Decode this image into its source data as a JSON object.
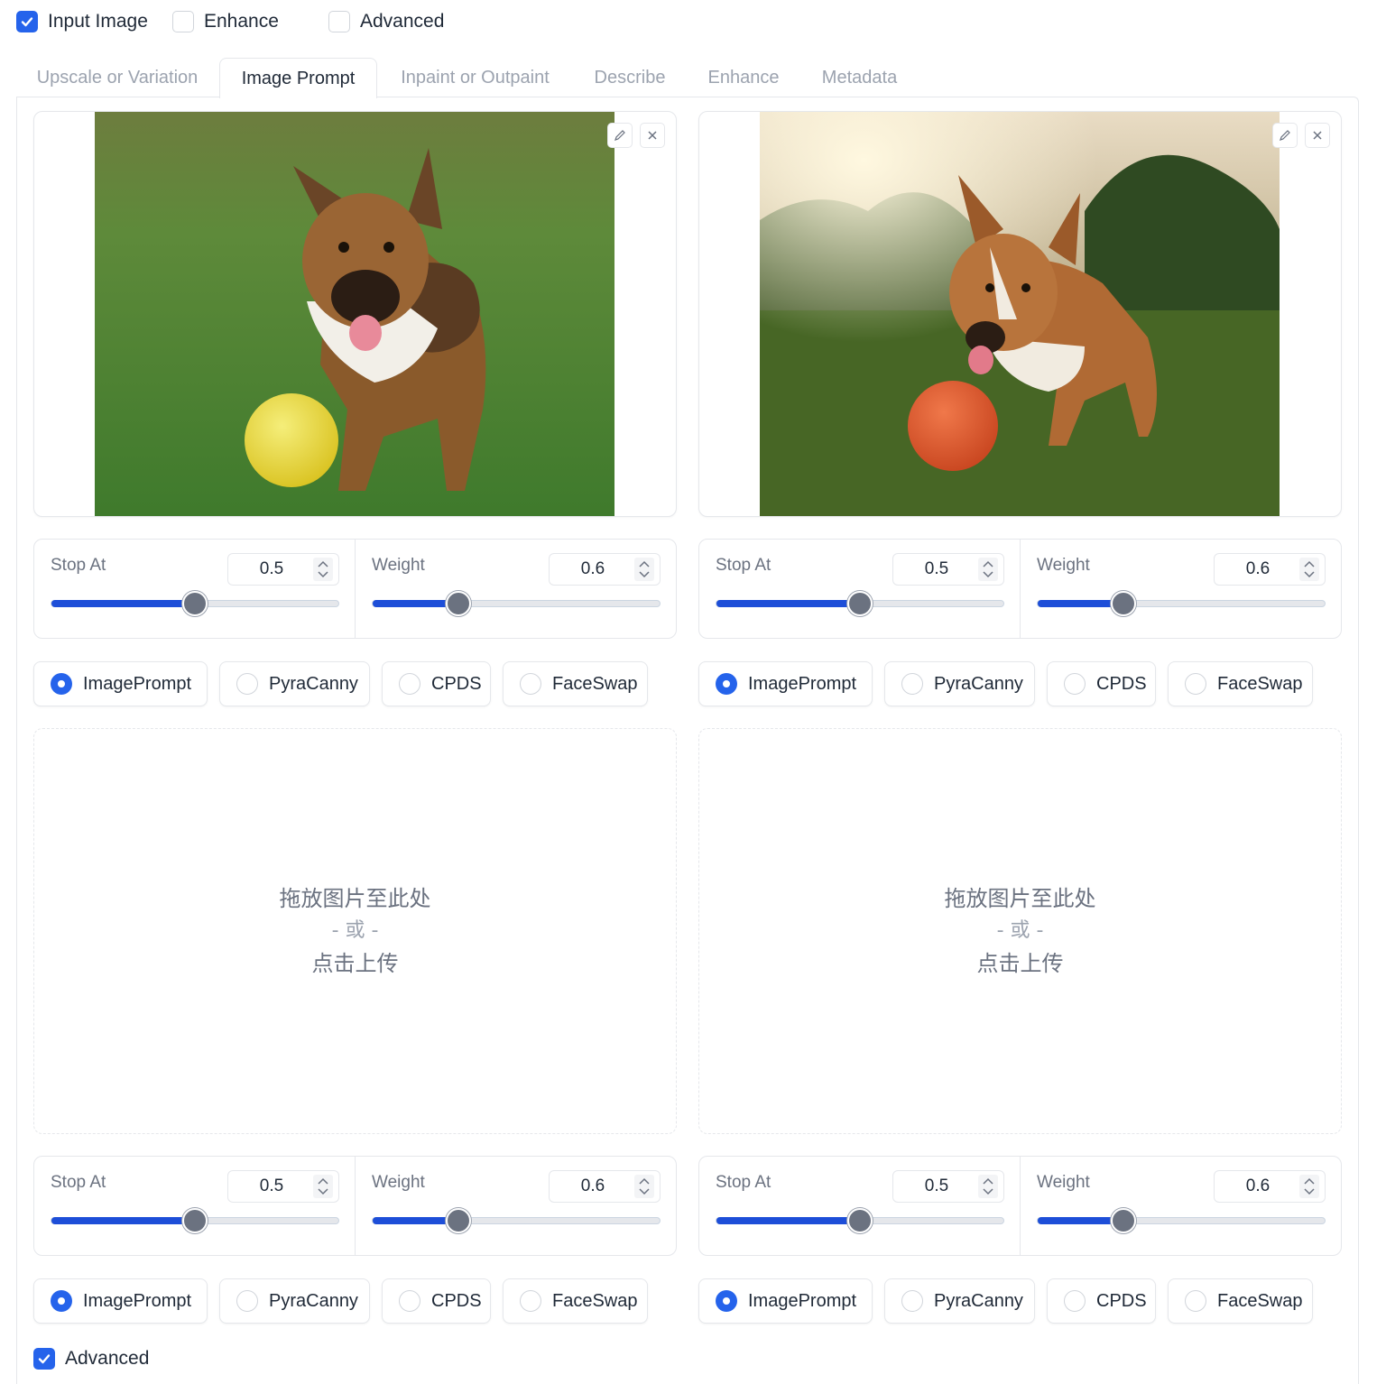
{
  "checkboxes": {
    "input_image": {
      "label": "Input Image",
      "checked": true
    },
    "enhance": {
      "label": "Enhance",
      "checked": false
    },
    "advanced": {
      "label": "Advanced",
      "checked": false
    }
  },
  "tabs": [
    {
      "label": "Upscale or Variation",
      "active": false
    },
    {
      "label": "Image Prompt",
      "active": true
    },
    {
      "label": "Inpaint or Outpaint",
      "active": false
    },
    {
      "label": "Describe",
      "active": false
    },
    {
      "label": "Enhance",
      "active": false
    },
    {
      "label": "Metadata",
      "active": false
    }
  ],
  "slots": [
    {
      "stop_label": "Stop At",
      "stop_value": "0.5",
      "stop_frac": 0.5,
      "weight_label": "Weight",
      "weight_value": "0.6",
      "weight_frac": 0.3,
      "types": [
        "ImagePrompt",
        "PyraCanny",
        "CPDS",
        "FaceSwap"
      ],
      "selected": "ImagePrompt",
      "image": "dog-with-yellow-ball"
    },
    {
      "stop_label": "Stop At",
      "stop_value": "0.5",
      "stop_frac": 0.5,
      "weight_label": "Weight",
      "weight_value": "0.6",
      "weight_frac": 0.3,
      "types": [
        "ImagePrompt",
        "PyraCanny",
        "CPDS",
        "FaceSwap"
      ],
      "selected": "ImagePrompt",
      "image": "dog-with-orange-ball"
    },
    {
      "stop_label": "Stop At",
      "stop_value": "0.5",
      "stop_frac": 0.5,
      "weight_label": "Weight",
      "weight_value": "0.6",
      "weight_frac": 0.3,
      "types": [
        "ImagePrompt",
        "PyraCanny",
        "CPDS",
        "FaceSwap"
      ],
      "selected": "ImagePrompt"
    },
    {
      "stop_label": "Stop At",
      "stop_value": "0.5",
      "stop_frac": 0.5,
      "weight_label": "Weight",
      "weight_value": "0.6",
      "weight_frac": 0.3,
      "types": [
        "ImagePrompt",
        "PyraCanny",
        "CPDS",
        "FaceSwap"
      ],
      "selected": "ImagePrompt"
    }
  ],
  "upload": {
    "drop_text": "拖放图片至此处",
    "or_text": "- 或 -",
    "click_text": "点击上传"
  },
  "bottom_advanced": {
    "label": "Advanced",
    "checked": true
  },
  "colors": {
    "accent": "#2563eb",
    "slider_fill": "#1d4ed8",
    "thumb": "#6b7280",
    "border": "#e5e7eb"
  },
  "icons": [
    "checkmark-icon",
    "edit-icon",
    "close-icon",
    "spinner-arrows-icon"
  ]
}
